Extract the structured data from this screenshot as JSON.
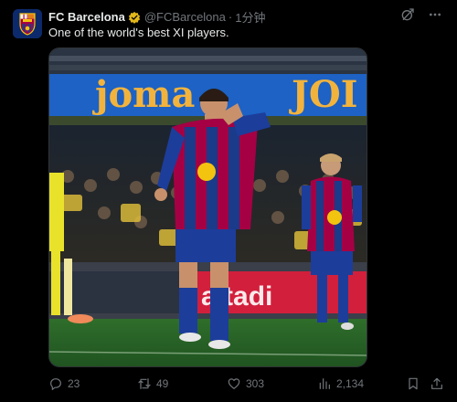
{
  "tweet": {
    "display_name": "FC Barcelona",
    "verified_badge_icon": "verified-gold-badge-icon",
    "handle": "@FCBarcelona",
    "separator": "·",
    "time": "1分钟",
    "text": "One of the world's best XI players."
  },
  "media": {
    "billboard_text": "joma",
    "billboard_text_right": "JOI",
    "ad_board_text": "altadi"
  },
  "actions": {
    "replies": "23",
    "reposts": "49",
    "likes": "303",
    "views": "2,134"
  },
  "colors": {
    "background": "#000000",
    "text_primary": "#e7e9ea",
    "text_secondary": "#71767b",
    "verified_gold": "#e2b719",
    "border": "#2f3336"
  },
  "icons": {
    "header_right": [
      "grok-icon",
      "more-icon"
    ],
    "action_bar": [
      "reply-icon",
      "repost-icon",
      "like-icon",
      "views-icon",
      "bookmark-icon",
      "share-icon"
    ]
  }
}
